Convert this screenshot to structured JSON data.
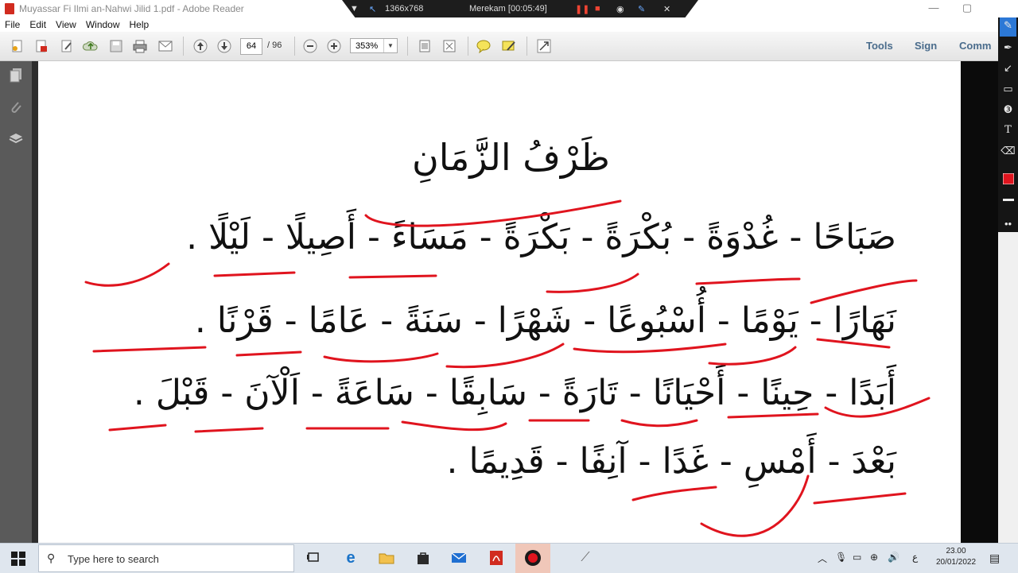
{
  "window": {
    "title": "Muyassar Fi Ilmi an-Nahwi Jilid 1.pdf - Adobe Reader",
    "controls": [
      "—",
      "▢",
      "✕"
    ]
  },
  "recorder": {
    "resolution": "1366x768",
    "status": "Merekam [00:05:49]"
  },
  "menu": [
    "File",
    "Edit",
    "View",
    "Window",
    "Help"
  ],
  "toolbar": {
    "current_page": "64",
    "total_pages": "/ 96",
    "zoom": "353%",
    "tools_label": "Tools",
    "sign_label": "Sign",
    "comment_label": "Comm"
  },
  "document": {
    "title_text": "ظَرْفُ الزَّمَانِ",
    "lines": [
      "صَبَاحًا - غُدْوَةً - بُكْرَةً - بَكْرَةً - مَسَاءً - أَصِيلًا - لَيْلًا .",
      "نَهَارًا - يَوْمًا - أُسْبُوعًا - شَهْرًا - سَنَةً - عَامًا - قَرْنًا .",
      "أَبَدًا - حِينًا - أَحْيَانًا - تَارَةً - سَابِقًا - سَاعَةً - اَلْآنَ - قَبْلَ .",
      "بَعْدَ - أَمْسِ - غَدًا - آنِفًا - قَدِيمًا ."
    ],
    "annotation_color": "#e0141e"
  },
  "taskbar": {
    "search_placeholder": "Type here to search",
    "time": "23.00",
    "date": "20/01/2022",
    "ime": "ع"
  },
  "colors": {
    "accent_red": "#e0141e",
    "toolbar_link": "#4a6c8c",
    "taskbar_bg": "#dfe6ee"
  }
}
